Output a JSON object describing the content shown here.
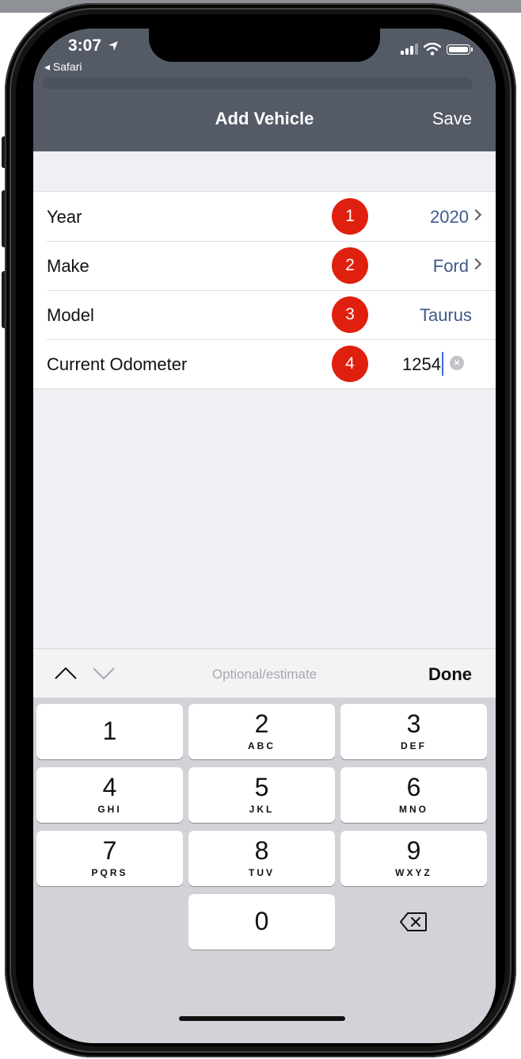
{
  "status_bar": {
    "time": "3:07",
    "back_app": "◂ Safari"
  },
  "nav": {
    "title": "Add Vehicle",
    "save_label": "Save"
  },
  "form": {
    "rows": [
      {
        "label": "Year",
        "value": "2020",
        "marker": "1"
      },
      {
        "label": "Make",
        "value": "Ford",
        "marker": "2"
      },
      {
        "label": "Model",
        "value": "Taurus",
        "marker": "3"
      },
      {
        "label": "Current Odometer",
        "value": "1254",
        "marker": "4"
      }
    ]
  },
  "keyboard": {
    "hint": "Optional/estimate",
    "done_label": "Done",
    "keys": [
      {
        "digit": "1",
        "letters": ""
      },
      {
        "digit": "2",
        "letters": "ABC"
      },
      {
        "digit": "3",
        "letters": "DEF"
      },
      {
        "digit": "4",
        "letters": "GHI"
      },
      {
        "digit": "5",
        "letters": "JKL"
      },
      {
        "digit": "6",
        "letters": "MNO"
      },
      {
        "digit": "7",
        "letters": "PQRS"
      },
      {
        "digit": "8",
        "letters": "TUV"
      },
      {
        "digit": "9",
        "letters": "WXYZ"
      },
      {
        "digit": "0",
        "letters": ""
      }
    ]
  },
  "colors": {
    "nav_bar": "#545b67",
    "value_text": "#3e5a8a",
    "marker": "#e0200e",
    "background": "#efeff4",
    "keypad": "#d1d3d9"
  }
}
